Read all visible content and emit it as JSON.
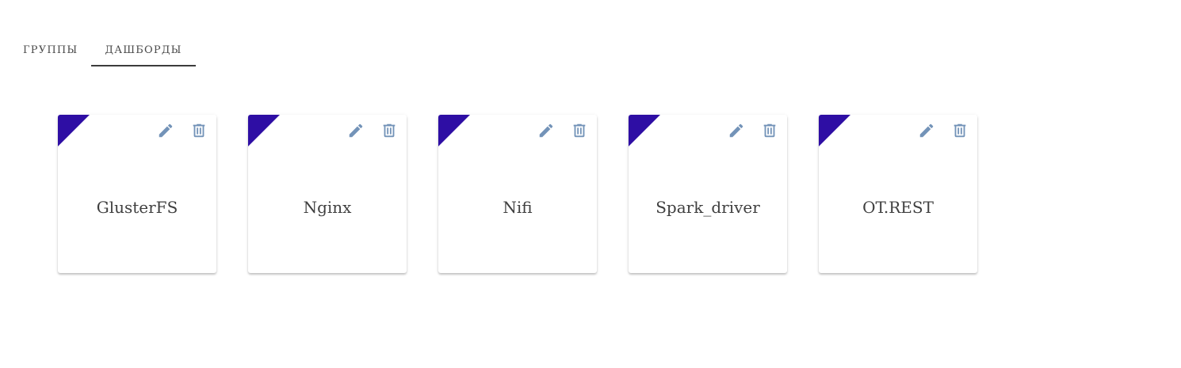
{
  "tabs": [
    {
      "label": "ГРУППЫ",
      "active": false
    },
    {
      "label": "ДАШБОРДЫ",
      "active": true
    }
  ],
  "cards": [
    {
      "title": "GlusterFS"
    },
    {
      "title": "Nginx"
    },
    {
      "title": "Nifi"
    },
    {
      "title": "Spark_driver"
    },
    {
      "title": "OT.REST"
    }
  ],
  "icons": {
    "edit": "pencil-icon",
    "delete": "trash-icon"
  },
  "colors": {
    "corner_accent": "#2e0ea4",
    "icon": "#7393b8",
    "tab_underline": "#3c3c3c",
    "text": "#3f3f3f"
  }
}
